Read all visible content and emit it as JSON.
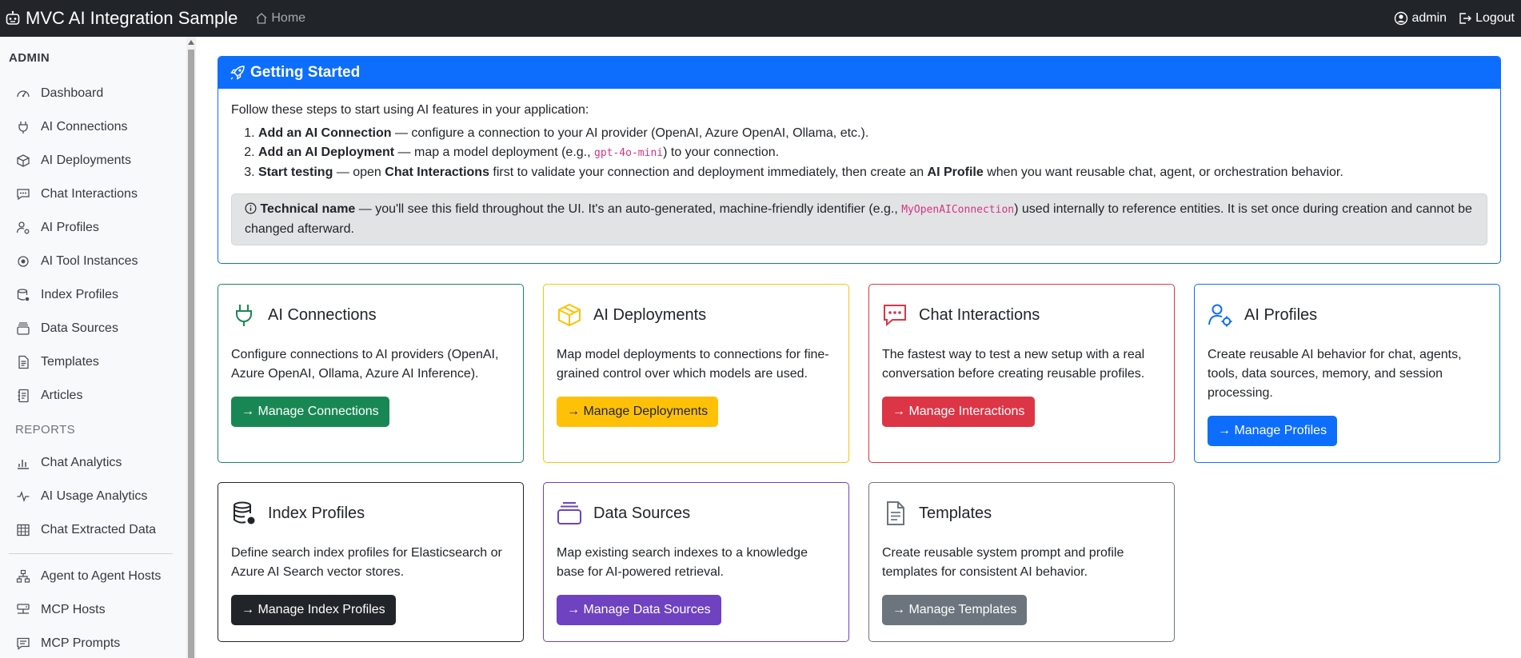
{
  "app": {
    "title": "MVC AI Integration Sample",
    "home_label": "Home"
  },
  "user": {
    "name": "admin",
    "logout_label": "Logout"
  },
  "sidebar": {
    "admin_heading": "ADMIN",
    "reports_heading": "REPORTS",
    "items": [
      {
        "label": "Dashboard",
        "icon": "speedometer-icon"
      },
      {
        "label": "AI Connections",
        "icon": "plug-icon"
      },
      {
        "label": "AI Deployments",
        "icon": "box-icon"
      },
      {
        "label": "Chat Interactions",
        "icon": "chat-dots-icon"
      },
      {
        "label": "AI Profiles",
        "icon": "person-gear-icon"
      },
      {
        "label": "AI Tool Instances",
        "icon": "tools-icon"
      },
      {
        "label": "Index Profiles",
        "icon": "database-gear-icon"
      },
      {
        "label": "Data Sources",
        "icon": "collection-icon"
      },
      {
        "label": "Templates",
        "icon": "file-text-icon"
      },
      {
        "label": "Articles",
        "icon": "journal-text-icon"
      }
    ],
    "report_items": [
      {
        "label": "Chat Analytics",
        "icon": "bar-chart-icon"
      },
      {
        "label": "AI Usage Analytics",
        "icon": "activity-icon"
      },
      {
        "label": "Chat Extracted Data",
        "icon": "table-icon"
      }
    ],
    "extra_items": [
      {
        "label": "Agent to Agent Hosts",
        "icon": "diagram-icon"
      },
      {
        "label": "MCP Hosts",
        "icon": "hdd-network-icon"
      },
      {
        "label": "MCP Prompts",
        "icon": "chat-square-text-icon"
      }
    ]
  },
  "getting_started": {
    "title": "Getting Started",
    "intro": "Follow these steps to start using AI features in your application:",
    "steps": [
      {
        "strong": "Add an AI Connection",
        "text": " — configure a connection to your AI provider (OpenAI, Azure OpenAI, Ollama, etc.)."
      },
      {
        "strong": "Add an AI Deployment",
        "text_before": " — map a model deployment (e.g., ",
        "code": "gpt-4o-mini",
        "text_after": ") to your connection."
      },
      {
        "strong": "Start testing",
        "text_before": " — open ",
        "strong2": "Chat Interactions",
        "text_mid": " first to validate your connection and deployment immediately, then create an ",
        "strong3": "AI Profile",
        "text_after": " when you want reusable chat, agent, or orchestration behavior."
      }
    ],
    "note": {
      "strong": "Technical name",
      "text_before": " — you'll see this field throughout the UI. It's an auto-generated, machine-friendly identifier (e.g., ",
      "code": "MyOpenAIConnection",
      "text_after": ") used internally to reference entities. It is set once during creation and cannot be changed afterward."
    }
  },
  "cards": [
    {
      "title": "AI Connections",
      "description": "Configure connections to AI providers (OpenAI, Azure OpenAI, Ollama, Azure AI Inference).",
      "button": "→ Manage Connections",
      "color": "#198754",
      "icon": "plug-icon"
    },
    {
      "title": "AI Deployments",
      "description": "Map model deployments to connections for fine-grained control over which models are used.",
      "button": "→ Manage Deployments",
      "color": "#ffc107",
      "icon": "box-icon"
    },
    {
      "title": "Chat Interactions",
      "description": "The fastest way to test a new setup with a real conversation before creating reusable profiles.",
      "button": "→ Manage Interactions",
      "color": "#dc3545",
      "icon": "chat-dots-icon"
    },
    {
      "title": "AI Profiles",
      "description": "Create reusable AI behavior for chat, agents, tools, data sources, memory, and session processing.",
      "button": "→ Manage Profiles",
      "color": "#0d6efd",
      "icon": "person-gear-icon"
    },
    {
      "title": "Index Profiles",
      "description": "Define search index profiles for Elasticsearch or Azure AI Search vector stores.",
      "button": "→ Manage Index Profiles",
      "color": "#212529",
      "icon": "database-gear-icon"
    },
    {
      "title": "Data Sources",
      "description": "Map existing search indexes to a knowledge base for AI-powered retrieval.",
      "button": "→ Manage Data Sources",
      "color": "#6f42c1",
      "icon": "collection-icon"
    },
    {
      "title": "Templates",
      "description": "Create reusable system prompt and profile templates for consistent AI behavior.",
      "button": "→ Manage Templates",
      "color": "#6c757d",
      "icon": "file-text-icon"
    }
  ],
  "colors": {
    "navbar": "#212529",
    "primary": "#0d6efd",
    "sidebar_bg": "#f8f9fa"
  }
}
